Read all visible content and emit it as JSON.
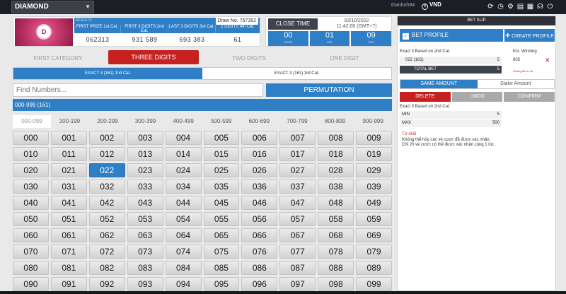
{
  "topbar": {
    "game": "DIAMOND",
    "user": "thanhnh94",
    "currency": "VND",
    "icons": [
      "refresh-icon",
      "history-icon",
      "settings-icon",
      "document-icon",
      "calculator-icon",
      "headset-icon",
      "logout-icon"
    ]
  },
  "results": {
    "logo_letter": "D",
    "label": "RESULTS",
    "draw_no": "Draw No. 767352",
    "columns": [
      {
        "header": "FIRST PRIZE 1st Cat.",
        "value": "062313"
      },
      {
        "header": "FIRST 3 DIGITS 2nd Cat.",
        "value": "931  589"
      },
      {
        "header": "LAST 3 DIGITS 3rd Cat.",
        "value": "693  383"
      },
      {
        "header": "2 DIGITS 4th Cat.",
        "value": "61"
      }
    ]
  },
  "close_time": {
    "label": "CLOSE TIME",
    "date": "03/10/2022",
    "time": "11:42:00 (GMT+7)",
    "hours": "00",
    "hours_unit": "HOUR",
    "minutes": "01",
    "minutes_unit": "MIN",
    "seconds": "09",
    "seconds_unit": "SEC"
  },
  "category_tabs": [
    "FIRST CATEGORY",
    "THREE DIGITS",
    "TWO DIGITS",
    "ONE DIGIT"
  ],
  "sub_tabs": [
    "EXACT 3 (161) 2nd Cat.",
    "EXACT 3 (161) 3rd Cat."
  ],
  "search": {
    "placeholder": "Find Numbers..."
  },
  "permutation_label": "PERMUTATION",
  "range_label": "000-999 (161)",
  "decades": [
    "000-099",
    "100-199",
    "200-299",
    "300-399",
    "400-499",
    "500-599",
    "600-699",
    "700-799",
    "800-899",
    "900-999"
  ],
  "grid": {
    "numbers": [
      "000",
      "001",
      "002",
      "003",
      "004",
      "005",
      "006",
      "007",
      "008",
      "009",
      "010",
      "011",
      "012",
      "013",
      "014",
      "015",
      "016",
      "017",
      "018",
      "019",
      "020",
      "021",
      "022",
      "023",
      "024",
      "025",
      "026",
      "027",
      "028",
      "029",
      "030",
      "031",
      "032",
      "033",
      "034",
      "035",
      "036",
      "037",
      "038",
      "039",
      "040",
      "041",
      "042",
      "043",
      "044",
      "045",
      "046",
      "047",
      "048",
      "049",
      "050",
      "051",
      "052",
      "053",
      "054",
      "055",
      "056",
      "057",
      "058",
      "059",
      "060",
      "061",
      "062",
      "063",
      "064",
      "065",
      "066",
      "067",
      "068",
      "069",
      "070",
      "071",
      "072",
      "073",
      "074",
      "075",
      "076",
      "077",
      "078",
      "079",
      "080",
      "081",
      "082",
      "083",
      "084",
      "085",
      "086",
      "087",
      "088",
      "089",
      "090",
      "091",
      "092",
      "093",
      "094",
      "095",
      "096",
      "097",
      "098",
      "099"
    ],
    "selected": "022"
  },
  "bet_slip": {
    "title": "BET SLIP",
    "profile_label": "BET PROFILE",
    "create_label": "CREATE PROFILE",
    "bet_type": "Exact 3 Based on 2nd Cat.",
    "est_label": "Est. Winning",
    "line_number": "022 (161)",
    "line_amount": "5",
    "est_value": "805",
    "warning": "Không đủ số dư",
    "total_label": "TOTAL BET",
    "total_value": "5",
    "amount_tabs": [
      "SAME AMOUNT",
      "Stake Amount"
    ],
    "actions": [
      "DELETE",
      "UNDO",
      "CONFIRM"
    ],
    "limit_title": "Exact 3 Based on 2nd Cat.",
    "min_label": "MIN",
    "min_value": "5",
    "max_label": "MAX",
    "max_value": "500",
    "error_title": "Từ chối",
    "error_lines": [
      "Không thể hủy các vé cược đã được xác nhận.",
      "Chỉ 20 vé cược có thể được xác nhận cùng 1 lúc."
    ]
  }
}
